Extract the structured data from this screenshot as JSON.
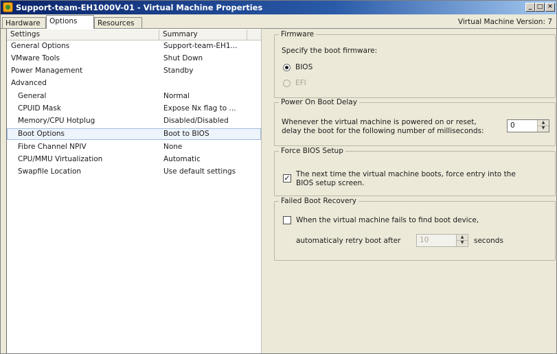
{
  "window": {
    "title": "Support-team-EH1000V-01 - Virtual Machine Properties",
    "controls": {
      "minimize": "_",
      "maximize": "□",
      "close": "✕"
    }
  },
  "tabs": [
    {
      "label": "Hardware"
    },
    {
      "label": "Options",
      "active": true
    },
    {
      "label": "Resources"
    }
  ],
  "vm_version": "Virtual Machine Version: 7",
  "options_list": {
    "columns": {
      "settings": "Settings",
      "summary": "Summary"
    },
    "rows": [
      {
        "name": "General Options",
        "summary": "Support-team-EH1..."
      },
      {
        "name": "VMware Tools",
        "summary": "Shut Down"
      },
      {
        "name": "Power Management",
        "summary": "Standby"
      },
      {
        "name": "Advanced",
        "summary": ""
      },
      {
        "name": "General",
        "summary": "Normal"
      },
      {
        "name": "CPUID Mask",
        "summary": "Expose Nx flag to ..."
      },
      {
        "name": "Memory/CPU Hotplug",
        "summary": "Disabled/Disabled"
      },
      {
        "name": "Boot Options",
        "summary": "Boot to BIOS",
        "selected": true
      },
      {
        "name": "Fibre Channel NPIV",
        "summary": "None"
      },
      {
        "name": "CPU/MMU Virtualization",
        "summary": "Automatic"
      },
      {
        "name": "Swapfile Location",
        "summary": "Use default settings"
      }
    ]
  },
  "firmware": {
    "title": "Firmware",
    "prompt": "Specify the boot firmware:",
    "options": [
      {
        "label": "BIOS",
        "checked": true,
        "enabled": true
      },
      {
        "label": "EFI",
        "checked": false,
        "enabled": false
      }
    ]
  },
  "boot_delay": {
    "title": "Power On Boot Delay",
    "line1": "Whenever the virtual machine is powered on or reset,",
    "line2": "delay the boot for the following number of milliseconds:",
    "value": "0"
  },
  "force_bios": {
    "title": "Force BIOS Setup",
    "checked": true,
    "line1": "The next time the virtual machine boots, force entry into the",
    "line2": "BIOS setup screen."
  },
  "failed_boot": {
    "title": "Failed Boot Recovery",
    "checked": false,
    "line1": "When the virtual machine fails to find boot device,",
    "retry_label": "automaticaly retry boot after",
    "retry_value": "10",
    "unit": "seconds"
  }
}
